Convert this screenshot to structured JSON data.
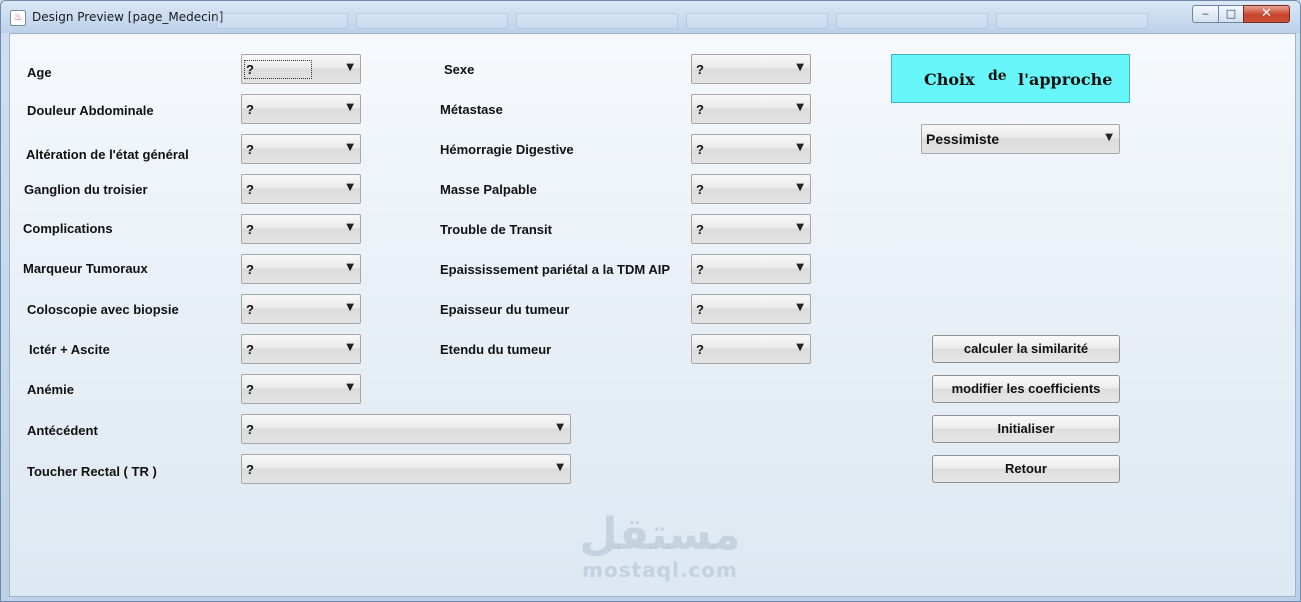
{
  "window": {
    "title": "Design Preview [page_Medecin]",
    "min_glyph": "‒",
    "max_glyph": "□",
    "close_glyph": "✕"
  },
  "left_fields": [
    {
      "label": "Age",
      "value": "?"
    },
    {
      "label": "Douleur Abdominale",
      "value": "?"
    },
    {
      "label": "Altération de l'état général",
      "value": "?"
    },
    {
      "label": "Ganglion du troisier",
      "value": "?"
    },
    {
      "label": "Complications",
      "value": "?"
    },
    {
      "label": "Marqueur Tumoraux",
      "value": "?"
    },
    {
      "label": "Coloscopie avec biopsie",
      "value": "?"
    },
    {
      "label": "Ictér + Ascite",
      "value": "?"
    },
    {
      "label": "Anémie",
      "value": "?"
    },
    {
      "label": "Antécédent",
      "value": "?"
    },
    {
      "label": "Toucher Rectal  ( TR )",
      "value": "?"
    }
  ],
  "middle_fields": [
    {
      "label": "Sexe",
      "value": "?"
    },
    {
      "label": "Métastase",
      "value": "?"
    },
    {
      "label": "Hémorragie Digestive",
      "value": "?"
    },
    {
      "label": "Masse Palpable",
      "value": "?"
    },
    {
      "label": "Trouble de Transit",
      "value": "?"
    },
    {
      "label": "Epaississement pariétal a la TDM AIP",
      "value": "?"
    },
    {
      "label": "Epaisseur du tumeur",
      "value": "?"
    },
    {
      "label": "Etendu du tumeur",
      "value": "?"
    }
  ],
  "approach": {
    "word1": "Choix",
    "word2": "de",
    "word3": "l'approche",
    "value": "Pessimiste",
    "box_color": "#67f7fa"
  },
  "buttons": {
    "calc": "calculer la similarité",
    "modify": "modifier les coefficients",
    "init": "Initialiser",
    "back": "Retour"
  },
  "arrow_glyph": "▼",
  "watermark": {
    "arabic": "مستقل",
    "latin": "mostaql.com"
  }
}
